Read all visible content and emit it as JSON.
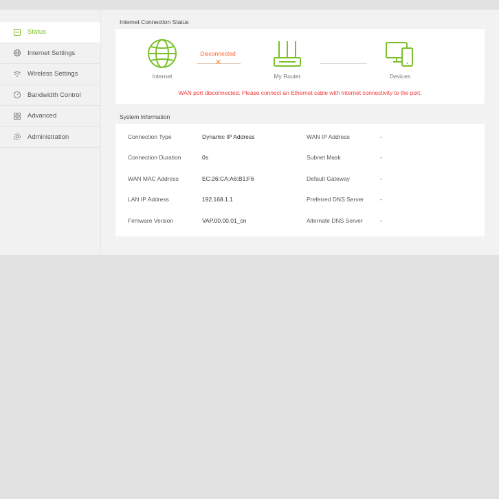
{
  "sidebar": {
    "items": [
      {
        "label": "Status",
        "icon": "status-icon",
        "active": true
      },
      {
        "label": "Internet Settings",
        "icon": "globe-icon"
      },
      {
        "label": "Wireless Settings",
        "icon": "wifi-icon"
      },
      {
        "label": "Bandwidth Control",
        "icon": "gauge-icon"
      },
      {
        "label": "Advanced",
        "icon": "grid-icon"
      },
      {
        "label": "Administration",
        "icon": "gear-icon"
      }
    ]
  },
  "connection": {
    "title": "Internet Connection Status",
    "internet_label": "Internet",
    "router_label": "My Router",
    "devices_label": "Devices",
    "status_label": "Disconnected",
    "warning": "WAN port disconnected. Please connect an Ethernet cable with Internet connectivity to the port."
  },
  "system": {
    "title": "System Information",
    "rows": [
      {
        "label": "Connection Type",
        "value": "Dynamic IP Address",
        "label2": "WAN IP Address",
        "value2": "-"
      },
      {
        "label": "Connection Duration",
        "value": "0s",
        "label2": "Subnet Mask",
        "value2": "-"
      },
      {
        "label": "WAN MAC Address",
        "value": "EC:26:CA:A6:B1:F6",
        "label2": "Default Gateway",
        "value2": "-"
      },
      {
        "label": "LAN IP Address",
        "value": "192.168.1.1",
        "label2": "Preferred DNS Server",
        "value2": "-"
      },
      {
        "label": "Firmware Version",
        "value": "VAP.00.00.01_cn",
        "label2": "Alternate DNS Server",
        "value2": "-"
      }
    ]
  },
  "colors": {
    "accent": "#7bbf2a",
    "error": "#f03838",
    "disconnected": "#ff5a2a"
  }
}
